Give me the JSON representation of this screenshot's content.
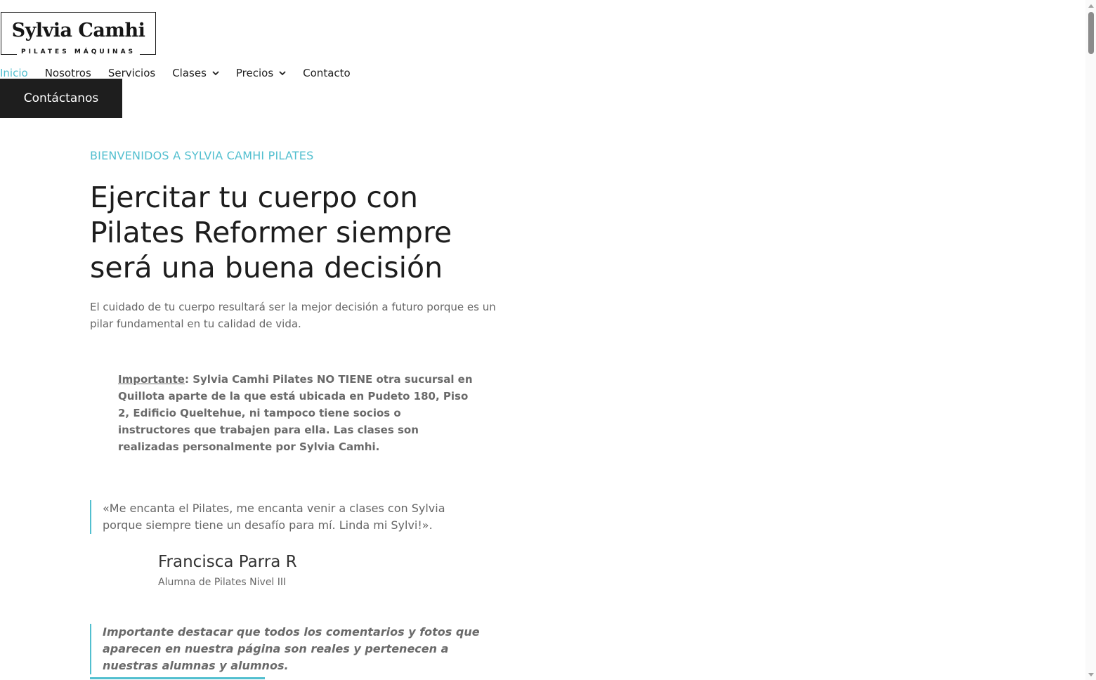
{
  "logo": {
    "title": "Sylvia Camhi",
    "subtitle": "PILATES MÁQUINAS"
  },
  "nav": {
    "items": [
      {
        "label": "Inicio",
        "active": true
      },
      {
        "label": "Nosotros"
      },
      {
        "label": "Servicios"
      },
      {
        "label": "Clases",
        "dropdown": true
      },
      {
        "label": "Precios",
        "dropdown": true
      },
      {
        "label": "Contacto"
      }
    ]
  },
  "cta": {
    "label": "Contáctanos"
  },
  "hero": {
    "eyebrow": "BIENVENIDOS A SYLVIA CAMHI PILATES",
    "headline_line1": "Ejercitar tu cuerpo con",
    "headline_line2": "Pilates Reformer siempre",
    "headline_line3": "será una buena decisión",
    "lead": "El cuidado de tu cuerpo resultará ser la mejor decisión a futuro porque es un pilar fundamental en tu calidad de vida."
  },
  "notice": {
    "label": "Importante",
    "text": ": Sylvia Camhi Pilates NO TIENE otra sucursal en Quillota aparte de la que está ubicada en Pudeto 180, Piso 2, Edificio Queltehue, ni tampoco tiene socios o instructores que trabajen para ella. Las clases son realizadas personalmente por Sylvia Camhi."
  },
  "testimonial": {
    "quote": "«Me encanta el Pilates, me encanta venir a clases con Sylvia porque siempre tiene un desafío para mí. Linda mi Sylvi!».",
    "author": "Francisca Parra R",
    "role": "Alumna de Pilates Nivel III"
  },
  "note": {
    "text": "Importante destacar que todos los comentarios y fotos que aparecen en nuestra página son reales y pertenecen a nuestras alumnas y alumnos."
  },
  "colors": {
    "accent": "#52bfcf",
    "dark": "#1e1e1e",
    "muted": "#666666"
  },
  "icons": {
    "dropdown": "chevron-down-icon"
  }
}
